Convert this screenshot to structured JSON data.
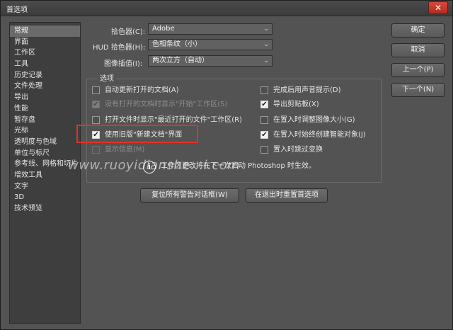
{
  "window": {
    "title": "首选项",
    "close_glyph": "✕"
  },
  "sidebar": {
    "items": [
      {
        "label": "常规",
        "selected": true
      },
      {
        "label": "界面"
      },
      {
        "label": "工作区"
      },
      {
        "label": "工具"
      },
      {
        "label": "历史记录"
      },
      {
        "label": "文件处理"
      },
      {
        "label": "导出"
      },
      {
        "label": "性能"
      },
      {
        "label": "暂存盘"
      },
      {
        "label": "光标"
      },
      {
        "label": "透明度与色域"
      },
      {
        "label": "单位与标尺"
      },
      {
        "label": "参考线、网格和切片"
      },
      {
        "label": "增效工具"
      },
      {
        "label": "文字"
      },
      {
        "label": "3D"
      },
      {
        "label": "技术预览"
      }
    ]
  },
  "general": {
    "color_picker_label": "拾色器(C):",
    "color_picker_value": "Adobe",
    "hud_picker_label": "HUD 拾色器(H):",
    "hud_picker_value": "色相条纹（小）",
    "interpolation_label": "图像插值(I):",
    "interpolation_value": "两次立方（自动）"
  },
  "options": {
    "title": "选项",
    "left": [
      {
        "label": "自动更新打开的文档(A)",
        "checked": false,
        "enabled": true
      },
      {
        "label": "没有打开的文档时显示\"开始\"工作区(S)",
        "checked": true,
        "enabled": false
      },
      {
        "label": "打开文件时显示\"最近打开的文件\"工作区(R)",
        "checked": false,
        "enabled": true
      },
      {
        "label": "使用旧版\"新建文档\"界面",
        "checked": true,
        "enabled": true
      },
      {
        "label": "显示信息(M)",
        "checked": false,
        "enabled": false
      }
    ],
    "right": [
      {
        "label": "完成后用声音提示(D)",
        "checked": false,
        "enabled": true
      },
      {
        "label": "导出剪贴板(X)",
        "checked": true,
        "enabled": true
      },
      {
        "label": "在置入时调整图像大小(G)",
        "checked": false,
        "enabled": true
      },
      {
        "label": "在置入时始终创建智能对象(J)",
        "checked": true,
        "enabled": true
      },
      {
        "label": "置入时跳过变换",
        "checked": false,
        "enabled": true
      }
    ],
    "note": "工作区更改将在下一次启动 Photoshop 时生效。"
  },
  "bottom_buttons": {
    "reset_warnings": "复位所有警告对话框(W)",
    "reset_prefs": "在退出时重置首选项"
  },
  "right_buttons": {
    "ok": "确定",
    "cancel": "取消",
    "prev": "上一个(P)",
    "next": "下一个(N)"
  },
  "watermark": "www.ruoyidianshe...i.com",
  "info_glyph": "i",
  "check_glyph": "✔",
  "chevron_glyph": "⌄",
  "colors": {
    "highlight": "#e0312b",
    "background": "#535353"
  }
}
